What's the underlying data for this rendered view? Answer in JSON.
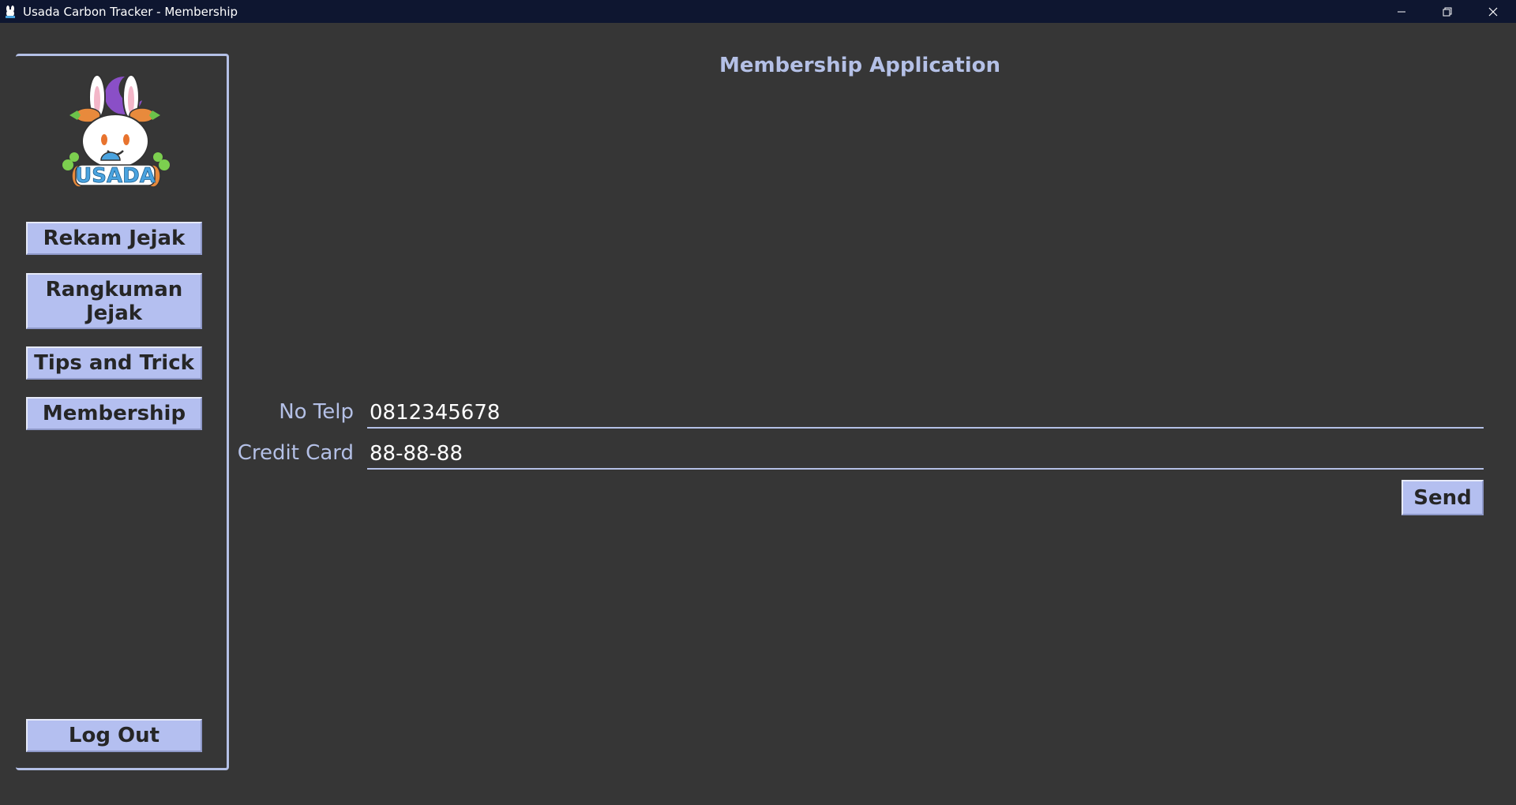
{
  "window": {
    "title": "Usada Carbon Tracker - Membership"
  },
  "sidebar": {
    "logo_text": "USADA",
    "items": [
      {
        "label": "Rekam Jejak"
      },
      {
        "label": "Rangkuman Jejak"
      },
      {
        "label": "Tips and Trick"
      },
      {
        "label": "Membership"
      }
    ],
    "logout_label": "Log Out"
  },
  "main": {
    "title": "Membership Application",
    "fields": [
      {
        "label": "No Telp",
        "value": "0812345678"
      },
      {
        "label": "Credit Card",
        "value": "88-88-88"
      }
    ],
    "send_label": "Send"
  },
  "colors": {
    "background": "#363636",
    "titlebar": "#0e1630",
    "accent": "#b4c0e6",
    "button": "#b4bff0"
  }
}
